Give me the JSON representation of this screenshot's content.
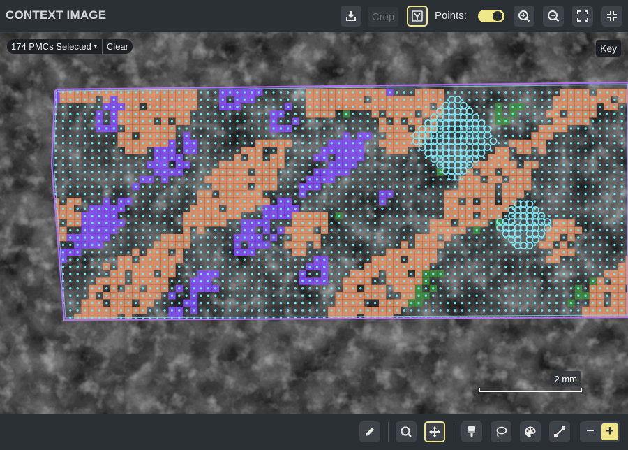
{
  "header": {
    "title": "CONTEXT IMAGE",
    "crop_label": "Crop",
    "points_label": "Points:",
    "points_toggle_on": true,
    "icons": {
      "export": "download-icon",
      "select_mode": "selection-mode-icon",
      "zoom_in": "zoom-in-icon",
      "zoom_out": "zoom-out-icon",
      "fit": "fit-to-view-icon",
      "collapse": "collapse-icon"
    }
  },
  "viewport": {
    "selection": {
      "count_label": "174 PMCs Selected",
      "caret": "▾",
      "clear_label": "Clear"
    },
    "key_label": "Key",
    "scale_bar_label": "2 mm"
  },
  "layers": {
    "colors": {
      "outline": "#b070f0",
      "outline_inner": "#7fd8ff",
      "point": "#6fe3ee",
      "orange": "#e8956a",
      "purple": "#8a4fff",
      "green": "#3f8f3f",
      "selection_ring": "#7fe5f5"
    }
  },
  "footer": {
    "tools": [
      {
        "name": "draw-tool",
        "icon": "pencil-icon",
        "active": false
      },
      {
        "name": "zoom-tool",
        "icon": "magnifier-icon",
        "active": false
      },
      {
        "name": "pan-tool",
        "icon": "move-arrows-icon",
        "active": true
      },
      {
        "name": "brush-tool",
        "icon": "paint-brush-icon",
        "active": false
      },
      {
        "name": "lasso-tool",
        "icon": "lasso-icon",
        "active": false
      },
      {
        "name": "color-tool",
        "icon": "palette-icon",
        "active": false
      },
      {
        "name": "line-tool",
        "icon": "line-ruler-icon",
        "active": false
      }
    ],
    "brush_minus": "−",
    "brush_plus": "+"
  },
  "accent_color": "#f0e68c"
}
